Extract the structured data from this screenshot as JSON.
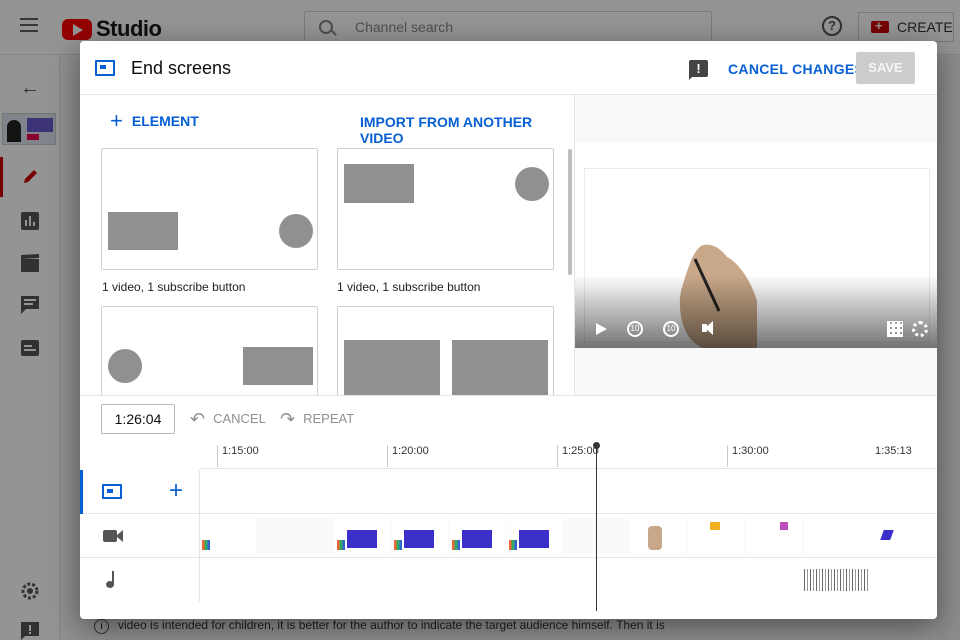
{
  "topbar": {
    "studio_label": "Studio",
    "search_placeholder": "Channel search",
    "help_symbol": "?",
    "create_label": "CREATE"
  },
  "sidebar": {
    "back_symbol": "←"
  },
  "dialog": {
    "title": "End screens",
    "cancel_changes_label": "CANCEL CHANGES",
    "save_label": "SAVE",
    "feedback_symbol": "!"
  },
  "templates": {
    "add_element_label": "ELEMENT",
    "add_element_symbol": "+",
    "import_label": "IMPORT FROM ANOTHER VIDEO",
    "cards": [
      {
        "caption": "1 video, 1 subscribe button"
      },
      {
        "caption": "1 video, 1 subscribe button"
      },
      {
        "caption": ""
      },
      {
        "caption": ""
      }
    ]
  },
  "toolbar": {
    "time_value": "1:26:04",
    "undo_label": "CANCEL",
    "redo_label": "REPEAT",
    "undo_symbol": "↶",
    "redo_symbol": "↷"
  },
  "timeline": {
    "ticks": [
      "1:15:00",
      "1:20:00",
      "1:25:00",
      "1:30:00",
      "1:35:13"
    ],
    "add_symbol": "+"
  },
  "background": {
    "footer_text": "video is intended for children, it is better for the author to indicate the target audience himself. Then it is",
    "info_symbol": "i"
  },
  "colors": {
    "accent": "#065fd4",
    "brand_red": "#ff0000",
    "disabled_button": "#cccccc"
  }
}
